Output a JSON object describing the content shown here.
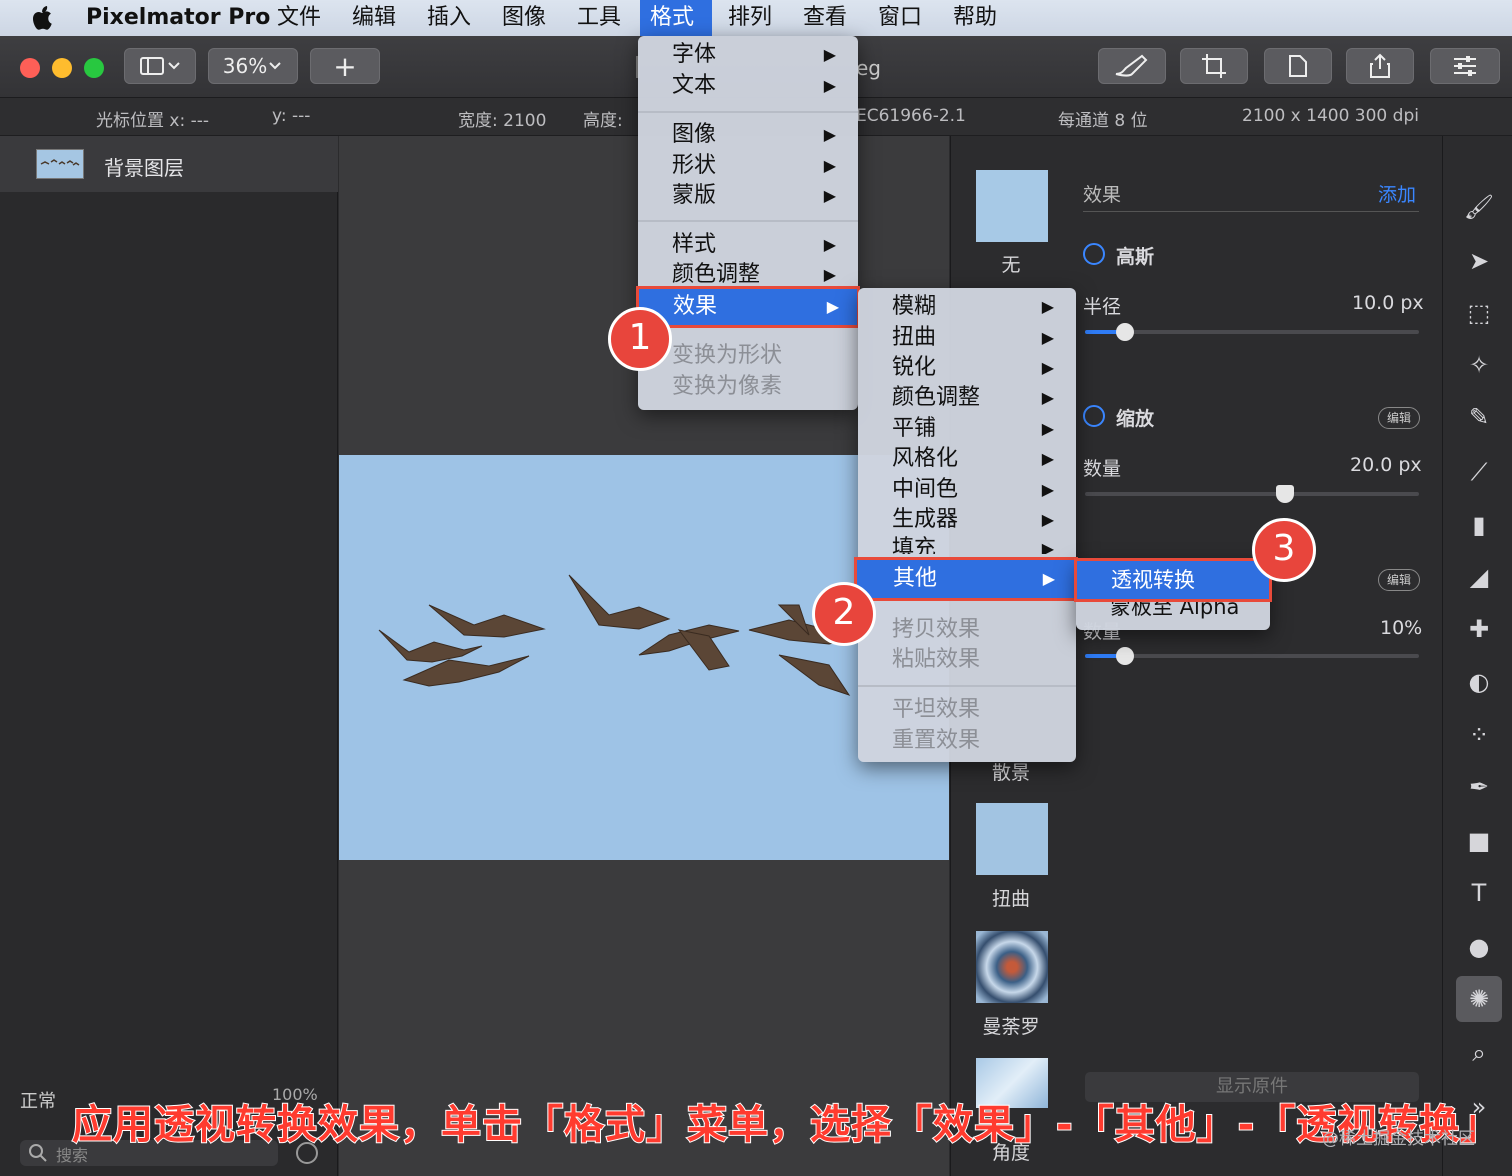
{
  "menubar": {
    "app_name": "Pixelmator Pro",
    "items": [
      "文件",
      "编辑",
      "插入",
      "图像",
      "工具",
      "格式",
      "排列",
      "查看",
      "窗口",
      "帮助"
    ],
    "active_item": "格式"
  },
  "toolbar": {
    "zoom": "36%",
    "add": "+",
    "filename_fragment": "eg"
  },
  "infobar": {
    "cursor_x": "光标位置 x:  ---",
    "cursor_y": "y:  ---",
    "width": "宽度:  2100",
    "height": "高度:",
    "color_profile": "EC61966-2.1",
    "bit_depth": "每通道 8 位",
    "dimensions": "2100 x 1400 300 dpi"
  },
  "layers": {
    "layer_name": "背景图层",
    "blend_mode": "正常",
    "opacity": "100%",
    "search_placeholder": "搜索"
  },
  "effects_browser": {
    "items": [
      "无",
      "散景",
      "扭曲",
      "曼荼罗",
      "角度"
    ]
  },
  "inspector": {
    "header": "效果",
    "add": "添加",
    "effect1_name": "高斯",
    "effect1_param": "半径",
    "effect1_value": "10.0 px",
    "effect1_level": 0.12,
    "effect2_name": "缩放",
    "effect2_param": "数量",
    "effect2_value": "20.0 px",
    "effect2_level": 0.6,
    "edit_label": "编辑",
    "effect3_param": "数量",
    "effect3_value": "10%",
    "effect3_level": 0.12,
    "show_original": "显示原件"
  },
  "format_menu": {
    "items": [
      "字体",
      "文本",
      "图像",
      "形状",
      "蒙版",
      "样式",
      "颜色调整",
      "效果",
      "变换为形状",
      "变换为像素"
    ]
  },
  "effects_submenu": {
    "items": [
      "模糊",
      "扭曲",
      "锐化",
      "颜色调整",
      "平铺",
      "风格化",
      "中间色",
      "生成器",
      "填充",
      "其他",
      "拷贝效果",
      "粘贴效果",
      "平坦效果",
      "重置效果"
    ]
  },
  "other_submenu": {
    "items": [
      "透视转换",
      "蒙板至 Alpha"
    ]
  },
  "badges": [
    "1",
    "2",
    "3"
  ],
  "caption": "应用透视转换效果，单击「格式」菜单，选择「效果」-「其他」-「透视转换」",
  "watermark": "@稀土掘金技术社区",
  "colors": {
    "accent": "#2f6fe0",
    "callout": "#e8453c",
    "sky": "#9ec3e6"
  }
}
